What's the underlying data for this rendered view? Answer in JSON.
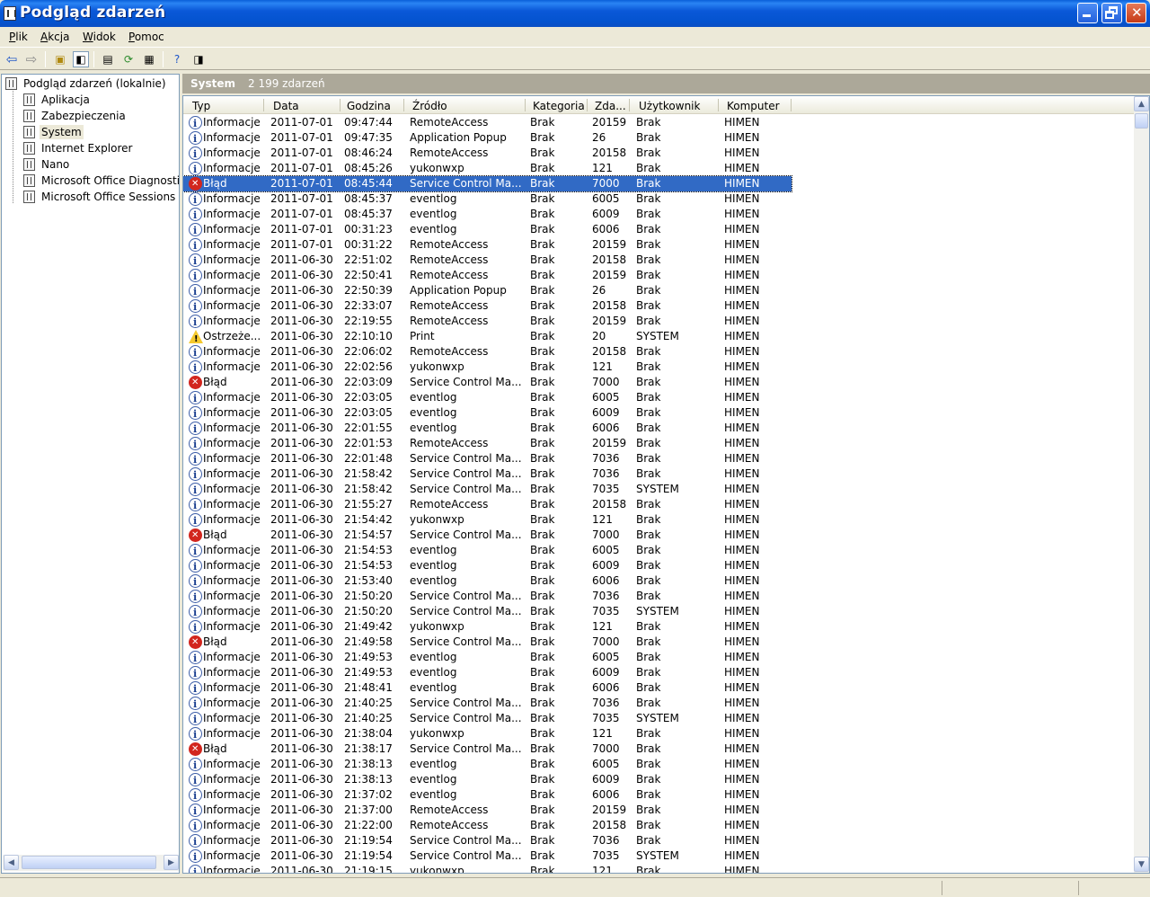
{
  "window": {
    "title": "Podgląd zdarzeń"
  },
  "menu": [
    {
      "label": "Plik",
      "ul": "P",
      "rest": "lik"
    },
    {
      "label": "Akcja",
      "ul": "A",
      "rest": "kcja"
    },
    {
      "label": "Widok",
      "ul": "W",
      "rest": "idok"
    },
    {
      "label": "Pomoc",
      "ul": "P",
      "rest": "omoc"
    }
  ],
  "tree": {
    "root": "Podgląd zdarzeń (lokalnie)",
    "items": [
      "Aplikacja",
      "Zabezpieczenia",
      "System",
      "Internet Explorer",
      "Nano",
      "Microsoft Office Diagnostics",
      "Microsoft Office Sessions"
    ],
    "selected": "System"
  },
  "panel": {
    "title": "System",
    "count": "2 199 zdarzeń"
  },
  "columns": [
    "Typ",
    "Data",
    "Godzina",
    "Źródło",
    "Kategoria",
    "Zda...",
    "Użytkownik",
    "Komputer"
  ],
  "rows": [
    [
      "info",
      "Informacje",
      "2011-07-01",
      "09:47:44",
      "RemoteAccess",
      "Brak",
      "20159",
      "Brak",
      "HIMEN"
    ],
    [
      "info",
      "Informacje",
      "2011-07-01",
      "09:47:35",
      "Application Popup",
      "Brak",
      "26",
      "Brak",
      "HIMEN"
    ],
    [
      "info",
      "Informacje",
      "2011-07-01",
      "08:46:24",
      "RemoteAccess",
      "Brak",
      "20158",
      "Brak",
      "HIMEN"
    ],
    [
      "info",
      "Informacje",
      "2011-07-01",
      "08:45:26",
      "yukonwxp",
      "Brak",
      "121",
      "Brak",
      "HIMEN"
    ],
    [
      "err",
      "Błąd",
      "2011-07-01",
      "08:45:44",
      "Service Control Ma...",
      "Brak",
      "7000",
      "Brak",
      "HIMEN"
    ],
    [
      "info",
      "Informacje",
      "2011-07-01",
      "08:45:37",
      "eventlog",
      "Brak",
      "6005",
      "Brak",
      "HIMEN"
    ],
    [
      "info",
      "Informacje",
      "2011-07-01",
      "08:45:37",
      "eventlog",
      "Brak",
      "6009",
      "Brak",
      "HIMEN"
    ],
    [
      "info",
      "Informacje",
      "2011-07-01",
      "00:31:23",
      "eventlog",
      "Brak",
      "6006",
      "Brak",
      "HIMEN"
    ],
    [
      "info",
      "Informacje",
      "2011-07-01",
      "00:31:22",
      "RemoteAccess",
      "Brak",
      "20159",
      "Brak",
      "HIMEN"
    ],
    [
      "info",
      "Informacje",
      "2011-06-30",
      "22:51:02",
      "RemoteAccess",
      "Brak",
      "20158",
      "Brak",
      "HIMEN"
    ],
    [
      "info",
      "Informacje",
      "2011-06-30",
      "22:50:41",
      "RemoteAccess",
      "Brak",
      "20159",
      "Brak",
      "HIMEN"
    ],
    [
      "info",
      "Informacje",
      "2011-06-30",
      "22:50:39",
      "Application Popup",
      "Brak",
      "26",
      "Brak",
      "HIMEN"
    ],
    [
      "info",
      "Informacje",
      "2011-06-30",
      "22:33:07",
      "RemoteAccess",
      "Brak",
      "20158",
      "Brak",
      "HIMEN"
    ],
    [
      "info",
      "Informacje",
      "2011-06-30",
      "22:19:55",
      "RemoteAccess",
      "Brak",
      "20159",
      "Brak",
      "HIMEN"
    ],
    [
      "warn",
      "Ostrzeże...",
      "2011-06-30",
      "22:10:10",
      "Print",
      "Brak",
      "20",
      "SYSTEM",
      "HIMEN"
    ],
    [
      "info",
      "Informacje",
      "2011-06-30",
      "22:06:02",
      "RemoteAccess",
      "Brak",
      "20158",
      "Brak",
      "HIMEN"
    ],
    [
      "info",
      "Informacje",
      "2011-06-30",
      "22:02:56",
      "yukonwxp",
      "Brak",
      "121",
      "Brak",
      "HIMEN"
    ],
    [
      "err",
      "Błąd",
      "2011-06-30",
      "22:03:09",
      "Service Control Ma...",
      "Brak",
      "7000",
      "Brak",
      "HIMEN"
    ],
    [
      "info",
      "Informacje",
      "2011-06-30",
      "22:03:05",
      "eventlog",
      "Brak",
      "6005",
      "Brak",
      "HIMEN"
    ],
    [
      "info",
      "Informacje",
      "2011-06-30",
      "22:03:05",
      "eventlog",
      "Brak",
      "6009",
      "Brak",
      "HIMEN"
    ],
    [
      "info",
      "Informacje",
      "2011-06-30",
      "22:01:55",
      "eventlog",
      "Brak",
      "6006",
      "Brak",
      "HIMEN"
    ],
    [
      "info",
      "Informacje",
      "2011-06-30",
      "22:01:53",
      "RemoteAccess",
      "Brak",
      "20159",
      "Brak",
      "HIMEN"
    ],
    [
      "info",
      "Informacje",
      "2011-06-30",
      "22:01:48",
      "Service Control Ma...",
      "Brak",
      "7036",
      "Brak",
      "HIMEN"
    ],
    [
      "info",
      "Informacje",
      "2011-06-30",
      "21:58:42",
      "Service Control Ma...",
      "Brak",
      "7036",
      "Brak",
      "HIMEN"
    ],
    [
      "info",
      "Informacje",
      "2011-06-30",
      "21:58:42",
      "Service Control Ma...",
      "Brak",
      "7035",
      "SYSTEM",
      "HIMEN"
    ],
    [
      "info",
      "Informacje",
      "2011-06-30",
      "21:55:27",
      "RemoteAccess",
      "Brak",
      "20158",
      "Brak",
      "HIMEN"
    ],
    [
      "info",
      "Informacje",
      "2011-06-30",
      "21:54:42",
      "yukonwxp",
      "Brak",
      "121",
      "Brak",
      "HIMEN"
    ],
    [
      "err",
      "Błąd",
      "2011-06-30",
      "21:54:57",
      "Service Control Ma...",
      "Brak",
      "7000",
      "Brak",
      "HIMEN"
    ],
    [
      "info",
      "Informacje",
      "2011-06-30",
      "21:54:53",
      "eventlog",
      "Brak",
      "6005",
      "Brak",
      "HIMEN"
    ],
    [
      "info",
      "Informacje",
      "2011-06-30",
      "21:54:53",
      "eventlog",
      "Brak",
      "6009",
      "Brak",
      "HIMEN"
    ],
    [
      "info",
      "Informacje",
      "2011-06-30",
      "21:53:40",
      "eventlog",
      "Brak",
      "6006",
      "Brak",
      "HIMEN"
    ],
    [
      "info",
      "Informacje",
      "2011-06-30",
      "21:50:20",
      "Service Control Ma...",
      "Brak",
      "7036",
      "Brak",
      "HIMEN"
    ],
    [
      "info",
      "Informacje",
      "2011-06-30",
      "21:50:20",
      "Service Control Ma...",
      "Brak",
      "7035",
      "SYSTEM",
      "HIMEN"
    ],
    [
      "info",
      "Informacje",
      "2011-06-30",
      "21:49:42",
      "yukonwxp",
      "Brak",
      "121",
      "Brak",
      "HIMEN"
    ],
    [
      "err",
      "Błąd",
      "2011-06-30",
      "21:49:58",
      "Service Control Ma...",
      "Brak",
      "7000",
      "Brak",
      "HIMEN"
    ],
    [
      "info",
      "Informacje",
      "2011-06-30",
      "21:49:53",
      "eventlog",
      "Brak",
      "6005",
      "Brak",
      "HIMEN"
    ],
    [
      "info",
      "Informacje",
      "2011-06-30",
      "21:49:53",
      "eventlog",
      "Brak",
      "6009",
      "Brak",
      "HIMEN"
    ],
    [
      "info",
      "Informacje",
      "2011-06-30",
      "21:48:41",
      "eventlog",
      "Brak",
      "6006",
      "Brak",
      "HIMEN"
    ],
    [
      "info",
      "Informacje",
      "2011-06-30",
      "21:40:25",
      "Service Control Ma...",
      "Brak",
      "7036",
      "Brak",
      "HIMEN"
    ],
    [
      "info",
      "Informacje",
      "2011-06-30",
      "21:40:25",
      "Service Control Ma...",
      "Brak",
      "7035",
      "SYSTEM",
      "HIMEN"
    ],
    [
      "info",
      "Informacje",
      "2011-06-30",
      "21:38:04",
      "yukonwxp",
      "Brak",
      "121",
      "Brak",
      "HIMEN"
    ],
    [
      "err",
      "Błąd",
      "2011-06-30",
      "21:38:17",
      "Service Control Ma...",
      "Brak",
      "7000",
      "Brak",
      "HIMEN"
    ],
    [
      "info",
      "Informacje",
      "2011-06-30",
      "21:38:13",
      "eventlog",
      "Brak",
      "6005",
      "Brak",
      "HIMEN"
    ],
    [
      "info",
      "Informacje",
      "2011-06-30",
      "21:38:13",
      "eventlog",
      "Brak",
      "6009",
      "Brak",
      "HIMEN"
    ],
    [
      "info",
      "Informacje",
      "2011-06-30",
      "21:37:02",
      "eventlog",
      "Brak",
      "6006",
      "Brak",
      "HIMEN"
    ],
    [
      "info",
      "Informacje",
      "2011-06-30",
      "21:37:00",
      "RemoteAccess",
      "Brak",
      "20159",
      "Brak",
      "HIMEN"
    ],
    [
      "info",
      "Informacje",
      "2011-06-30",
      "21:22:00",
      "RemoteAccess",
      "Brak",
      "20158",
      "Brak",
      "HIMEN"
    ],
    [
      "info",
      "Informacje",
      "2011-06-30",
      "21:19:54",
      "Service Control Ma...",
      "Brak",
      "7036",
      "Brak",
      "HIMEN"
    ],
    [
      "info",
      "Informacje",
      "2011-06-30",
      "21:19:54",
      "Service Control Ma...",
      "Brak",
      "7035",
      "SYSTEM",
      "HIMEN"
    ],
    [
      "info",
      "Informacje",
      "2011-06-30",
      "21:19:15",
      "yukonwxp",
      "Brak",
      "121",
      "Brak",
      "HIMEN"
    ]
  ],
  "selected_row": 4,
  "icons": {
    "back": "back-arrow-icon",
    "forward": "forward-arrow-icon",
    "up": "up-folder-icon",
    "tree": "show-tree-icon",
    "props": "properties-icon",
    "refresh": "refresh-icon",
    "export": "export-list-icon",
    "help": "help-icon",
    "console": "console-icon"
  }
}
